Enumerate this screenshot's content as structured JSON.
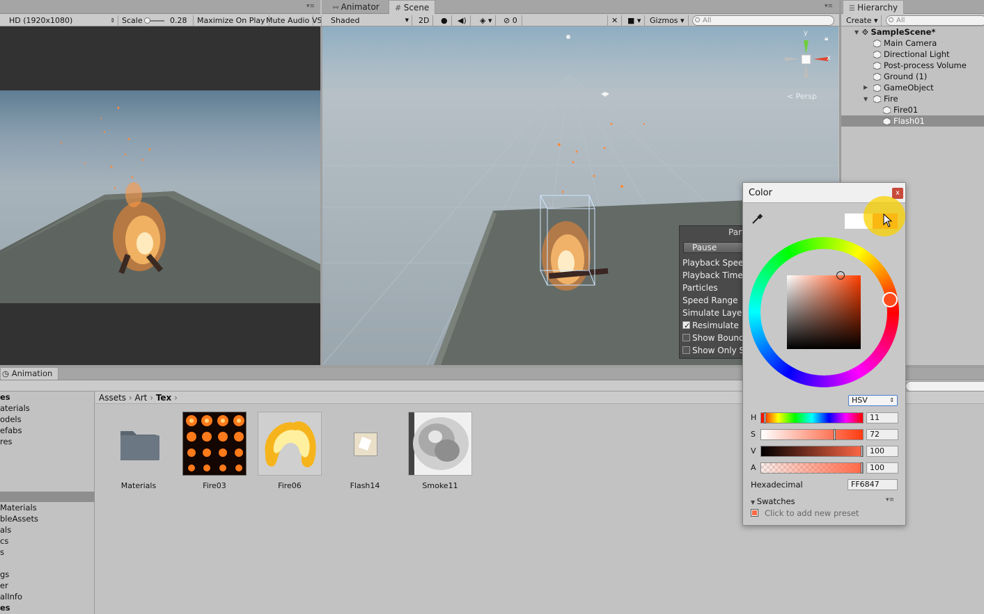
{
  "game_view": {
    "resolution": "HD (1920x1080)",
    "scale_label": "Scale",
    "scale_value": "0.28",
    "maximize": "Maximize On Play",
    "mute": "Mute Audio",
    "stats": "VS"
  },
  "scene_view": {
    "tabs": [
      "Animator",
      "Scene"
    ],
    "shading": "Shaded",
    "mode_2d": "2D",
    "hidden_count": "0",
    "gizmos": "Gizmos",
    "search_placeholder": "All",
    "persp_label": "< Persp",
    "gizmo_y": "y",
    "gizmo_x": "x"
  },
  "particle_panel": {
    "title": "Part",
    "pause": "Pause",
    "rows": [
      "Playback Speed",
      "Playback Time",
      "Particles",
      "Speed Range",
      "Simulate Layers"
    ],
    "checks": [
      {
        "label": "Resimulate",
        "checked": true
      },
      {
        "label": "Show Bounds",
        "checked": false
      },
      {
        "label": "Show Only S",
        "checked": false
      }
    ]
  },
  "hierarchy": {
    "tab": "Hierarchy",
    "create": "Create",
    "search_placeholder": "All",
    "scene": "SampleScene*",
    "items": [
      "Main Camera",
      "Directional Light",
      "Post-process Volume",
      "Ground (1)",
      "GameObject",
      "Fire",
      "Fire01",
      "Flash01"
    ],
    "selected": "Flash01"
  },
  "animation_tab": "Animation",
  "project": {
    "left_top": [
      "es",
      "aterials",
      "odels",
      "efabs",
      "res"
    ],
    "left_bottom": [
      "Materials",
      "bleAssets",
      "als",
      "cs",
      "s",
      "gs",
      "er",
      "alInfo",
      "es"
    ],
    "breadcrumb": [
      "Assets",
      "Art",
      "Tex"
    ],
    "assets": [
      "Materials",
      "Fire03",
      "Fire06",
      "Flash14",
      "Smoke11"
    ]
  },
  "color_picker": {
    "title": "Color",
    "close": "x",
    "mode": "HSV",
    "h": "11",
    "s": "72",
    "v": "100",
    "a": "100",
    "h_fraction": 0.03,
    "s_fraction": 0.72,
    "hex_label": "Hexadecimal",
    "hex": "FF6847",
    "swatches": "Swatches",
    "add_preset": "Click to add new preset",
    "colors": {
      "current": "#ff6847",
      "previous": "#ffffff"
    }
  }
}
